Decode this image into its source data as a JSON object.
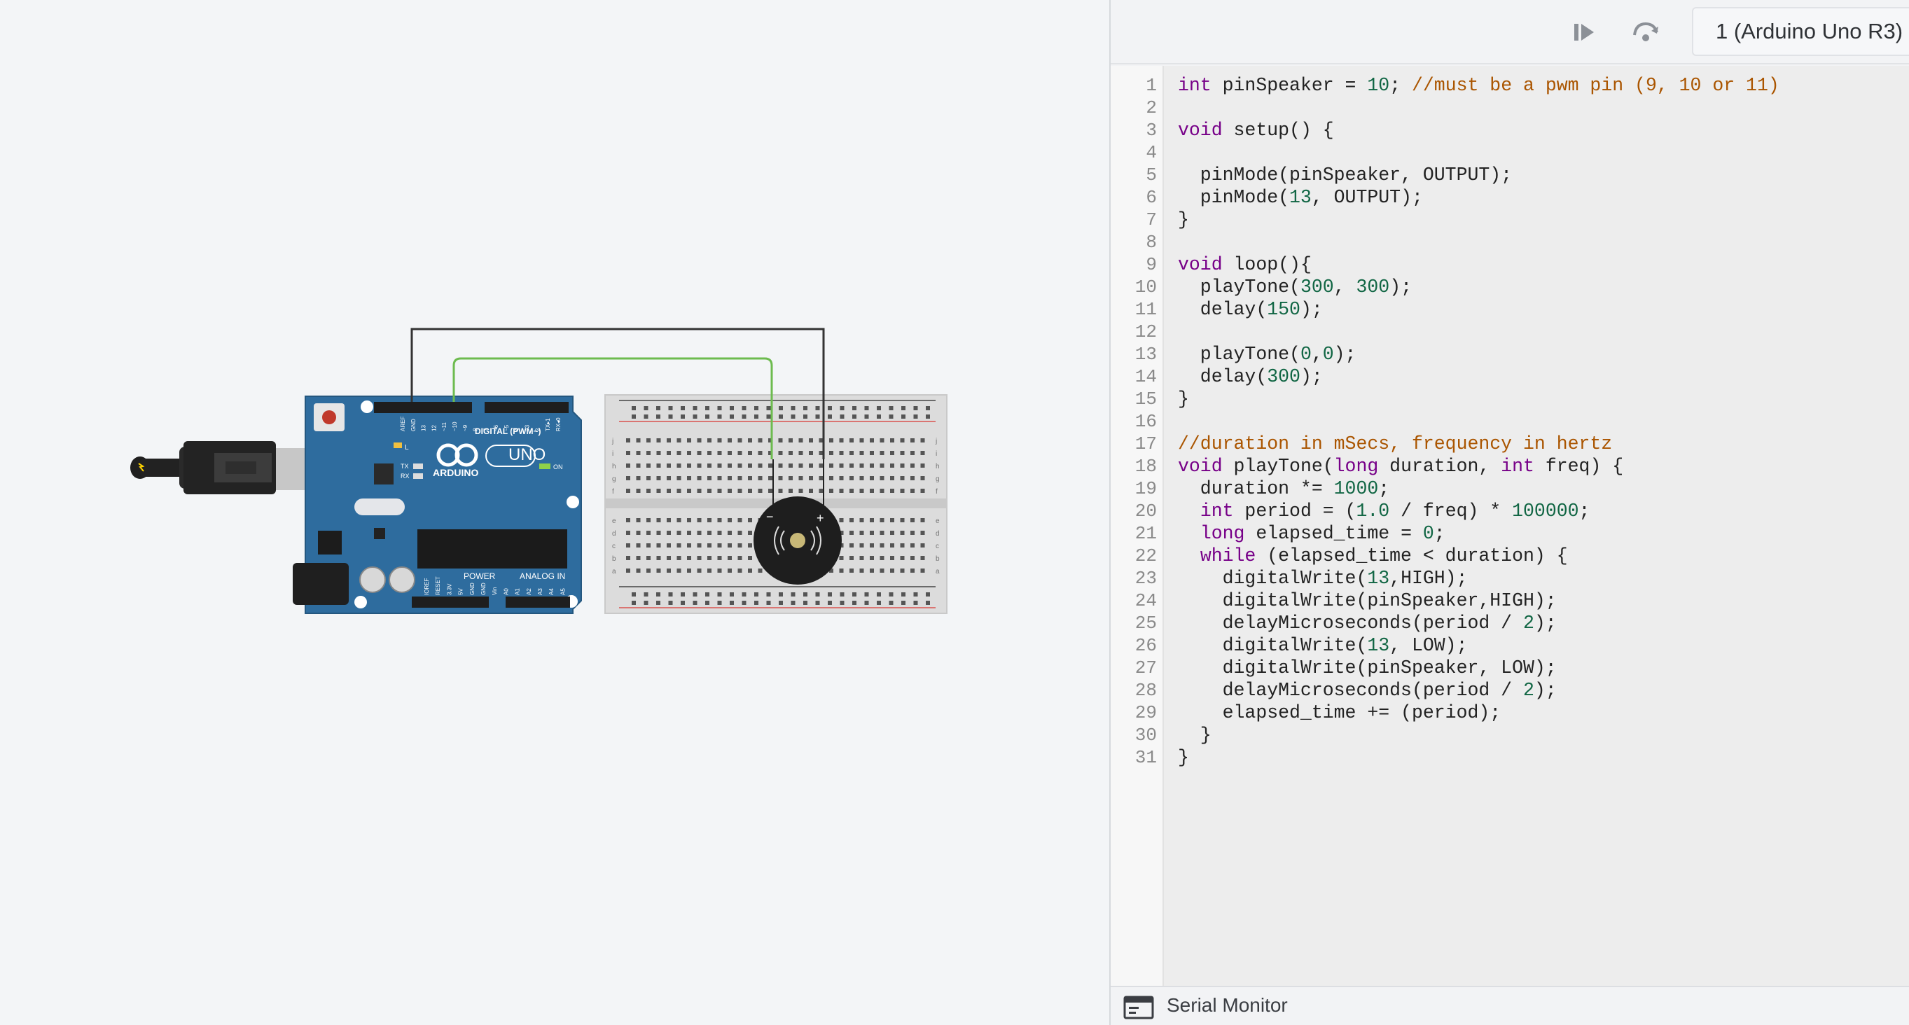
{
  "toolbar": {
    "device_label": "1 (Arduino Uno R3)",
    "icons": [
      "step-play-icon",
      "step-over-icon"
    ]
  },
  "board": {
    "brand": "ARDUINO",
    "model": "UNO",
    "digital_label": "DIGITAL (PWM~)",
    "power_label": "POWER",
    "analog_label": "ANALOG IN",
    "led_l": "L",
    "led_tx": "TX",
    "led_rx": "RX",
    "on_label": "ON",
    "top_pins": [
      "AREF",
      "GND",
      "13",
      "12",
      "~11",
      "~10",
      "~9",
      "8",
      "7",
      "~6",
      "~5",
      "4",
      "~3",
      "2",
      "TX▸1",
      "RX◂0"
    ],
    "bottom_pins": [
      "IOREF",
      "RESET",
      "3.3V",
      "5V",
      "GND",
      "GND",
      "Vin",
      "A0",
      "A1",
      "A2",
      "A3",
      "A4",
      "A5"
    ]
  },
  "breadboard": {
    "rows_top": [
      "j",
      "i",
      "h",
      "g",
      "f"
    ],
    "rows_bottom": [
      "e",
      "d",
      "c",
      "b",
      "a"
    ],
    "columns": 30
  },
  "buzzer": {
    "minus": "−",
    "plus": "+"
  },
  "code": {
    "lines": [
      [
        [
          "kw",
          "int"
        ],
        [
          "t",
          " pinSpeaker = "
        ],
        [
          "num",
          "10"
        ],
        [
          "t",
          "; "
        ],
        [
          "cm",
          "//must be a pwm pin (9, 10 or 11)"
        ]
      ],
      [],
      [
        [
          "kw",
          "void"
        ],
        [
          "t",
          " setup() {"
        ]
      ],
      [],
      [
        [
          "t",
          "  pinMode(pinSpeaker, OUTPUT);"
        ]
      ],
      [
        [
          "t",
          "  pinMode("
        ],
        [
          "num",
          "13"
        ],
        [
          "t",
          ", OUTPUT);"
        ]
      ],
      [
        [
          "t",
          "}"
        ]
      ],
      [],
      [
        [
          "kw",
          "void"
        ],
        [
          "t",
          " loop(){"
        ]
      ],
      [
        [
          "t",
          "  playTone("
        ],
        [
          "num",
          "300"
        ],
        [
          "t",
          ", "
        ],
        [
          "num",
          "300"
        ],
        [
          "t",
          ");"
        ]
      ],
      [
        [
          "t",
          "  delay("
        ],
        [
          "num",
          "150"
        ],
        [
          "t",
          ");"
        ]
      ],
      [],
      [
        [
          "t",
          "  playTone("
        ],
        [
          "num",
          "0"
        ],
        [
          "t",
          ","
        ],
        [
          "num",
          "0"
        ],
        [
          "t",
          ");"
        ]
      ],
      [
        [
          "t",
          "  delay("
        ],
        [
          "num",
          "300"
        ],
        [
          "t",
          ");"
        ]
      ],
      [
        [
          "t",
          "}"
        ]
      ],
      [],
      [
        [
          "cm",
          "//duration in mSecs, frequency in hertz"
        ]
      ],
      [
        [
          "kw",
          "void"
        ],
        [
          "t",
          " playTone("
        ],
        [
          "kw",
          "long"
        ],
        [
          "t",
          " duration, "
        ],
        [
          "kw",
          "int"
        ],
        [
          "t",
          " freq) {"
        ]
      ],
      [
        [
          "t",
          "  duration *= "
        ],
        [
          "num",
          "1000"
        ],
        [
          "t",
          ";"
        ]
      ],
      [
        [
          "t",
          "  "
        ],
        [
          "kw",
          "int"
        ],
        [
          "t",
          " period = ("
        ],
        [
          "num",
          "1.0"
        ],
        [
          "t",
          " / freq) * "
        ],
        [
          "num",
          "100000"
        ],
        [
          "t",
          ";"
        ]
      ],
      [
        [
          "t",
          "  "
        ],
        [
          "kw",
          "long"
        ],
        [
          "t",
          " elapsed_time = "
        ],
        [
          "num",
          "0"
        ],
        [
          "t",
          ";"
        ]
      ],
      [
        [
          "t",
          "  "
        ],
        [
          "kw",
          "while"
        ],
        [
          "t",
          " (elapsed_time < duration) {"
        ]
      ],
      [
        [
          "t",
          "    digitalWrite("
        ],
        [
          "num",
          "13"
        ],
        [
          "t",
          ",HIGH);"
        ]
      ],
      [
        [
          "t",
          "    digitalWrite(pinSpeaker,HIGH);"
        ]
      ],
      [
        [
          "t",
          "    delayMicroseconds(period / "
        ],
        [
          "num",
          "2"
        ],
        [
          "t",
          ");"
        ]
      ],
      [
        [
          "t",
          "    digitalWrite("
        ],
        [
          "num",
          "13"
        ],
        [
          "t",
          ", LOW);"
        ]
      ],
      [
        [
          "t",
          "    digitalWrite(pinSpeaker, LOW);"
        ]
      ],
      [
        [
          "t",
          "    delayMicroseconds(period / "
        ],
        [
          "num",
          "2"
        ],
        [
          "t",
          ");"
        ]
      ],
      [
        [
          "t",
          "    elapsed_time += (period);"
        ]
      ],
      [
        [
          "t",
          "  }"
        ]
      ],
      [
        [
          "t",
          "}"
        ]
      ]
    ]
  },
  "serial_monitor": {
    "label": "Serial Monitor"
  },
  "colors": {
    "board": "#2e6c9e",
    "wire_black": "#333333",
    "wire_green": "#6dbb4f",
    "rail_red": "#d9534f",
    "keyword": "#770088",
    "number": "#116644",
    "comment": "#aa5500"
  }
}
